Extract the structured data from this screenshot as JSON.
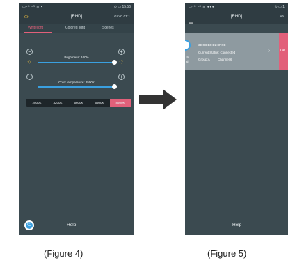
{
  "figure4": {
    "statusbar": {
      "left": "▭⁴ᴳ ⁴ᴳ ≋ ▪",
      "right": "⊙ ▭ 15:56"
    },
    "titlebar": {
      "title": "[RHD]",
      "right": "Grp:C Ch:1"
    },
    "tabs": [
      "Whitelight",
      "Colored light",
      "Scenes"
    ],
    "brightness": {
      "label": "Brightness: 100%",
      "value_percent": 100
    },
    "color_temp": {
      "label": "Color temperature: 8500K",
      "value_fraction": 1.0
    },
    "temps": [
      "2500K",
      "3200K",
      "5600K",
      "6500K",
      "8500K"
    ],
    "selected_temp": "8500K",
    "help": "Help"
  },
  "figure5": {
    "statusbar": {
      "left": "▭⁴ᴳ ⁴ᴳ ≋ ●●●",
      "right": "⊙ ▭ 1"
    },
    "titlebar": {
      "title": "[RHD]",
      "right": "Ab"
    },
    "device": {
      "mac": "3E:9D:B9:D2:8F:9E",
      "status": "Current Status: Connected",
      "group": "Group:A",
      "channel": "Channel:6",
      "left_text": "ht",
      "left_text2": "al"
    },
    "delete_label": "De",
    "help": "Help"
  },
  "captions": {
    "fig4": "(Figure 4)",
    "fig5": "(Figure 5)"
  }
}
